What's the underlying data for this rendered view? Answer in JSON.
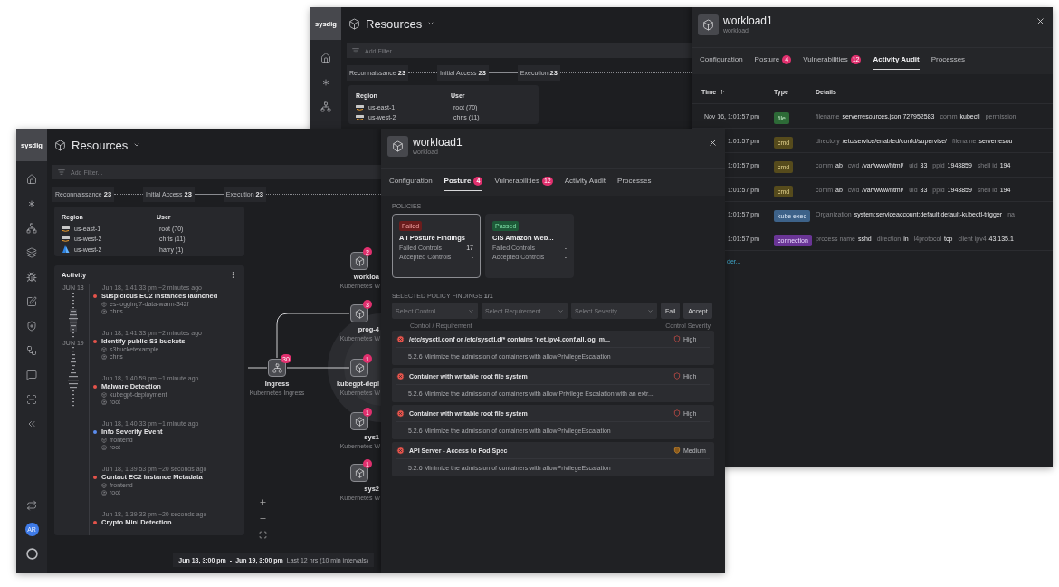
{
  "back_window": {
    "logo": "sysdig",
    "title": "Resources",
    "filter": {
      "placeholder": "Add Filter..."
    },
    "tactics": [
      {
        "label": "Reconnaissance",
        "count": "23",
        "solid_link": false
      },
      {
        "label": "Initial Access",
        "count": "23",
        "solid_link": true
      },
      {
        "label": "Execution",
        "count": "23",
        "solid_link": false
      }
    ],
    "region_card": {
      "columns": [
        "Region",
        "User"
      ],
      "rows": [
        {
          "kind": "aws",
          "region": "us-east-1",
          "user": "root (70)"
        },
        {
          "kind": "aws",
          "region": "us-west-2",
          "user": "chris (11)"
        }
      ]
    },
    "panel": {
      "title": "workload1",
      "subtitle": "workload",
      "tabs": [
        {
          "label": "Configuration",
          "selected": false
        },
        {
          "label": "Posture",
          "badge": "4",
          "selected": false
        },
        {
          "label": "Vulnerabilities",
          "badge": "12",
          "selected": false
        },
        {
          "label": "Activity Audit",
          "selected": true
        },
        {
          "label": "Processes",
          "selected": false
        }
      ],
      "table": {
        "columns": [
          "Time",
          "Type",
          "Details"
        ],
        "rows": [
          {
            "time": "Nov 16, 1:01:57 pm",
            "type": "file",
            "kind": "file",
            "details": [
              {
                "key": "filename",
                "value": "serverresources.json.727952583"
              },
              {
                "key": "comm",
                "value": "kubectl"
              },
              {
                "key": "permission"
              }
            ]
          },
          {
            "time": "1:01:57 pm",
            "type": "cmd",
            "kind": "cmd",
            "details": [
              {
                "key": "directory",
                "value": "/etc/service/enabled/confd/supervise/"
              },
              {
                "key": "filename",
                "value": "serverresou"
              }
            ]
          },
          {
            "time": "1:01:57 pm",
            "type": "cmd",
            "kind": "cmd",
            "details": [
              {
                "key": "comm",
                "value": "ab"
              },
              {
                "key": "cwd",
                "value": "/var/www/html/"
              },
              {
                "key": "uid",
                "value": "33"
              },
              {
                "key": "ppid",
                "value": "1943859"
              },
              {
                "key": "shell id",
                "value": "194"
              }
            ]
          },
          {
            "time": "1:01:57 pm",
            "type": "cmd",
            "kind": "cmd",
            "details": [
              {
                "key": "comm",
                "value": "ab"
              },
              {
                "key": "cwd",
                "value": "/var/www/html/"
              },
              {
                "key": "uid",
                "value": "33"
              },
              {
                "key": "ppid",
                "value": "1943859"
              },
              {
                "key": "shell id",
                "value": "194"
              }
            ]
          },
          {
            "time": "1:01:57 pm",
            "type": "kube exec",
            "kind": "kube",
            "details": [
              {
                "key": "Organization",
                "value": "system:serviceaccount:default:default-kubectl-trigger"
              },
              {
                "key": "na"
              }
            ]
          },
          {
            "time": "1:01:57 pm",
            "type": "connection",
            "kind": "connection",
            "details": [
              {
                "key": "process name",
                "value": "sshd"
              },
              {
                "key": "direction",
                "value": "in"
              },
              {
                "key": "l4protocol",
                "value": "tcp"
              },
              {
                "key": "client ipv4",
                "value": "43.135.1"
              }
            ]
          }
        ]
      },
      "more_link": "der..."
    }
  },
  "front_window": {
    "logo": "sysdig",
    "title": "Resources",
    "avatar": "AR",
    "filter": {
      "placeholder": "Add Filter..."
    },
    "tactics": [
      {
        "label": "Reconnaissance",
        "count": "23",
        "solid_link": false
      },
      {
        "label": "Initial Access",
        "count": "23",
        "solid_link": true
      },
      {
        "label": "Execution",
        "count": "23",
        "solid_link": false
      }
    ],
    "region_card": {
      "columns": [
        "Region",
        "User"
      ],
      "rows": [
        {
          "kind": "aws",
          "region": "us-east-1",
          "user": "root (70)"
        },
        {
          "kind": "aws",
          "region": "us-west-2",
          "user": "chris (11)"
        },
        {
          "kind": "azure",
          "region": "us-west-2",
          "user": "harry (1)"
        }
      ]
    },
    "activity": {
      "title": "Activity",
      "dates": [
        "JUN 18",
        "JUN 19"
      ],
      "events": [
        {
          "time": "Jun 18, 1:41:33 pm ~2 minutes ago",
          "title": "Suspicious EC2 instances launched",
          "resource": "es-logging7-data-warm-342f",
          "user": "chris",
          "color": "#e5534b"
        },
        {
          "time": "Jun 18, 1:41:33 pm ~2 minutes ago",
          "title": "Identify public S3 buckets",
          "resource": "s3bucketexample",
          "user": "chris",
          "color": "#e5534b"
        },
        {
          "time": "Jun 18, 1:40:59 pm ~1 minute ago",
          "title": "Malware Detection",
          "resource": "kubegpt-deployment",
          "user": "root",
          "color": "#e5534b"
        },
        {
          "time": "Jun 18, 1:40:33 pm ~1 minute ago",
          "title": "Info Severity Event",
          "resource": "frontend",
          "user": "root",
          "color": "#5b8def"
        },
        {
          "time": "Jun 18, 1:39:53 pm ~20 seconds ago",
          "title": "Contact EC2 Instance Metadata",
          "resource": "frontend",
          "user": "root",
          "color": "#e5534b"
        },
        {
          "time": "Jun 18, 1:39:33 pm ~20 seconds ago",
          "title": "Crypto Mini Detection",
          "color": "#e5534b"
        }
      ]
    },
    "graph": {
      "nodes": [
        {
          "name": "workloa",
          "type": "Kubernetes W",
          "badge": "2"
        },
        {
          "name": "prog-4",
          "type": "Kubernetes W",
          "badge": "3"
        },
        {
          "name": "Ingress",
          "type": "Kubernetes Ingress",
          "badge": "30"
        },
        {
          "name": "kubegpt-depl",
          "type": "Kubernetes W",
          "badge": "1"
        },
        {
          "name": "sys1",
          "type": "Kubernetes W",
          "badge": "1"
        },
        {
          "name": "sys2",
          "type": "Kubernetes W",
          "badge": "1"
        }
      ]
    },
    "time_range": {
      "start": "Jun 18, 3:00 pm",
      "separator": "-",
      "end": "Jun 19, 3:00 pm",
      "interval": "Last 12 hrs (10 min intervals)"
    },
    "panel": {
      "title": "workload1",
      "subtitle": "workload",
      "tabs": [
        {
          "label": "Configuration",
          "selected": false
        },
        {
          "label": "Posture",
          "badge": "4",
          "selected": true
        },
        {
          "label": "Vulnerabilities",
          "badge": "12",
          "selected": false
        },
        {
          "label": "Activity Audit",
          "selected": false
        },
        {
          "label": "Processes",
          "selected": false
        }
      ],
      "policies_heading": "POLICIES",
      "policies": [
        {
          "status": "Failed",
          "kind": "failed",
          "name": "All Posture Findings",
          "selected": true,
          "stats": [
            {
              "label": "Failed Controls",
              "value": "17"
            },
            {
              "label": "Accepted Controls",
              "value": "-"
            }
          ]
        },
        {
          "status": "Passed",
          "kind": "passed",
          "name": "CIS Amazon Web...",
          "selected": false,
          "stats": [
            {
              "label": "Failed Controls",
              "value": "-"
            },
            {
              "label": "Accepted Controls",
              "value": "-"
            }
          ]
        }
      ],
      "findings_heading": "SELECTED POLICY FINDINGS **1/1**",
      "selects": [
        {
          "placeholder": "Select Control..."
        },
        {
          "placeholder": "Select Requirement..."
        },
        {
          "placeholder": "Select Severity..."
        }
      ],
      "buttons": [
        "Fail",
        "Accept"
      ],
      "columns": [
        "Control / Requirement",
        "Control Severity"
      ],
      "findings": [
        {
          "control": "/etc/sysctl.conf or /etc/sysctl.d/* contains 'net.ipv4.conf.all.log_m...",
          "requirement": "5.2.6 Minimize the admission of containers with allowPrivilegeEscalation",
          "severity": "High",
          "kind": "high"
        },
        {
          "control": "Container with writable root file system",
          "requirement": "5.2.6 Minimize the admission of containers with allow Privilege Escalation with an extr...",
          "severity": "High",
          "kind": "high"
        },
        {
          "control": "Container with writable root file system",
          "requirement": "5.2.6 Minimize the admission of containers with allowPrivilegeEscalation",
          "severity": "High",
          "kind": "high"
        },
        {
          "control": "API Server - Access to Pod Spec",
          "requirement": "5.2.6 Minimize the admission of containers with allowPrivilegeEscalation",
          "severity": "Medium",
          "kind": "medium"
        }
      ]
    }
  }
}
